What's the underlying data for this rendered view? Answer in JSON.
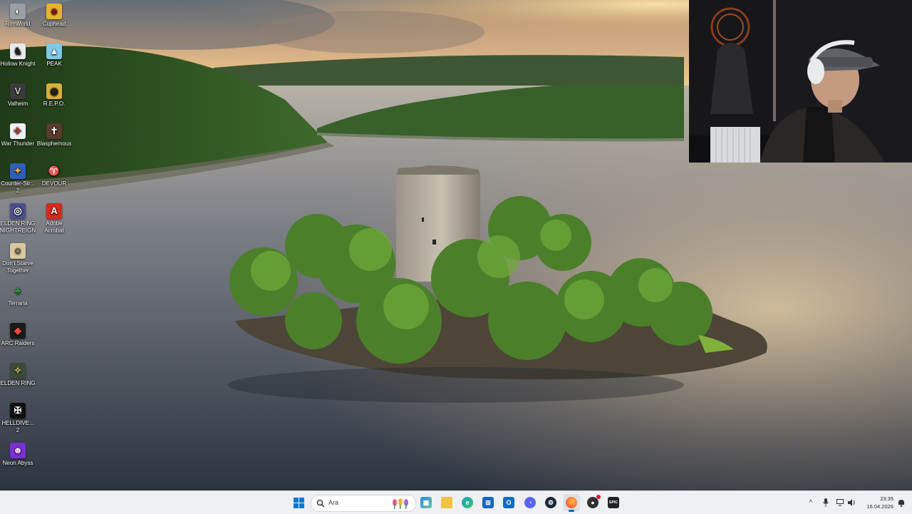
{
  "desktop": {
    "icons": [
      {
        "label": "RimWorld",
        "icon": "rimworld-icon"
      },
      {
        "label": "Cuphead",
        "icon": "cuphead-icon"
      },
      {
        "label": "Hollow Knight",
        "icon": "hollow-knight-icon"
      },
      {
        "label": "PEAK",
        "icon": "peak-icon"
      },
      {
        "label": "Valheim",
        "icon": "valheim-icon"
      },
      {
        "label": "R.E.P.O.",
        "icon": "repo-icon"
      },
      {
        "label": "War Thunder",
        "icon": "war-thunder-icon"
      },
      {
        "label": "Blasphemous",
        "icon": "blasphemous-icon"
      },
      {
        "label": "Counter-Str... 2",
        "icon": "counter-strike-icon"
      },
      {
        "label": "DEVOUR",
        "icon": "devour-icon"
      },
      {
        "label": "ELDEN RING NIGHTREIGN",
        "icon": "elden-ring-nightreign-icon"
      },
      {
        "label": "Adobe Acrobat",
        "icon": "adobe-acrobat-icon"
      },
      {
        "label": "Don't Starve Together",
        "icon": "dont-starve-icon"
      },
      {
        "label": "Terraria",
        "icon": "terraria-icon"
      },
      {
        "label": "ARC Raiders",
        "icon": "arc-raiders-icon"
      },
      {
        "label": "ELDEN RING",
        "icon": "elden-ring-icon"
      },
      {
        "label": "HELLDIVE... 2",
        "icon": "helldivers-icon"
      },
      {
        "label": "Neon Abyss",
        "icon": "neon-abyss-icon"
      }
    ]
  },
  "taskbar": {
    "search_placeholder": "Ara",
    "pinned": [
      {
        "name": "start-button",
        "icon": "windows-logo-icon",
        "color": "#0078d4"
      },
      {
        "name": "widgets",
        "icon": "widgets-icon",
        "color": "#2b88d8"
      },
      {
        "name": "file-explorer",
        "icon": "folder-icon",
        "color": "#f5c342"
      },
      {
        "name": "edge",
        "icon": "edge-icon",
        "color": "#1aa0c8"
      },
      {
        "name": "microsoft-store",
        "icon": "store-icon",
        "color": "#1565c0"
      },
      {
        "name": "outlook",
        "icon": "outlook-icon",
        "color": "#0f6cbd"
      },
      {
        "name": "discord",
        "icon": "discord-icon",
        "color": "#5865f2"
      },
      {
        "name": "steam",
        "icon": "steam-icon",
        "color": "#1b2838"
      },
      {
        "name": "firefox",
        "icon": "firefox-icon",
        "color": "#ff7139"
      },
      {
        "name": "obs",
        "icon": "obs-icon",
        "color": "#302e31"
      },
      {
        "name": "epic-games",
        "icon": "epic-games-icon",
        "color": "#222222"
      }
    ],
    "epic_label": "EPIC",
    "tray": {
      "chevron": "^",
      "time": "23:35",
      "date": "16.04.2026"
    }
  },
  "colors": {
    "taskbar_bg": "#eef0f4",
    "accent": "#0067c0"
  }
}
